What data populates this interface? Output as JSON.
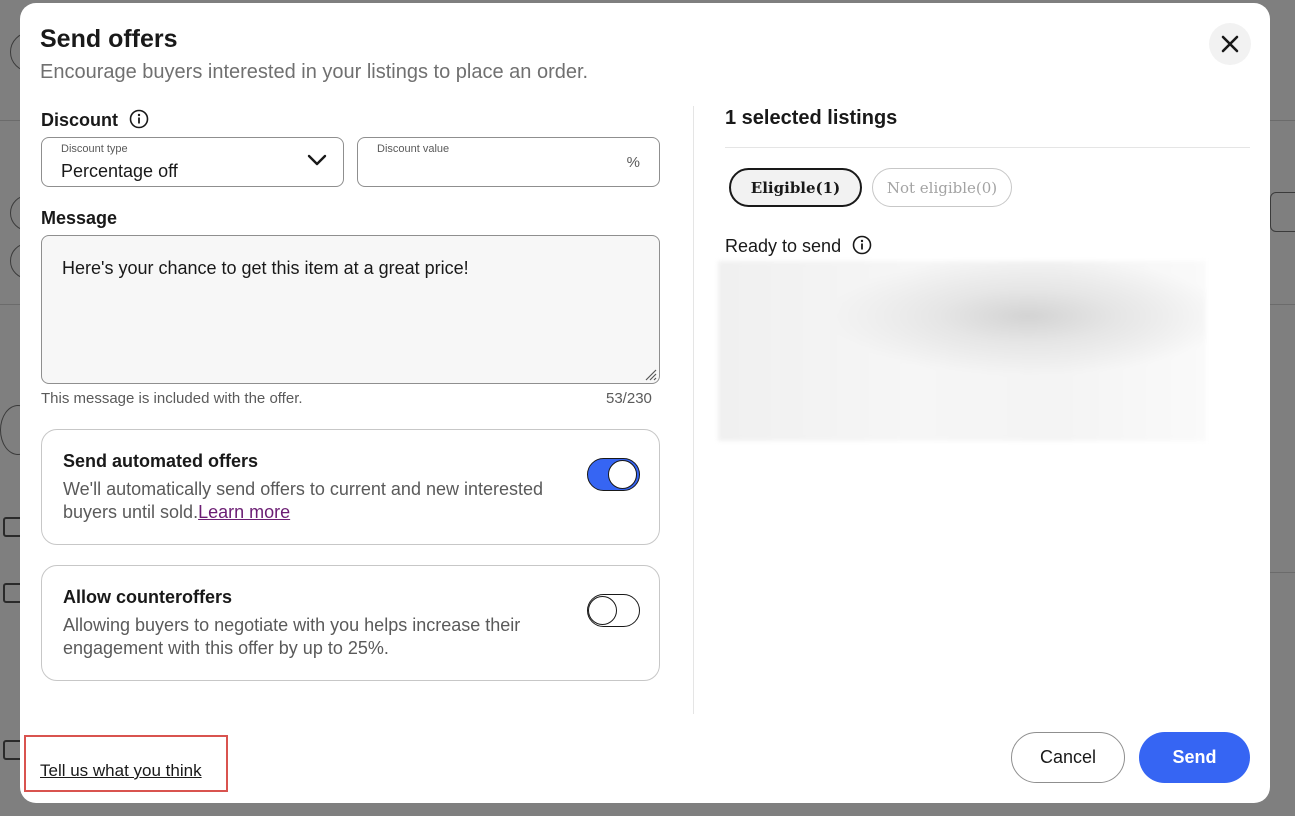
{
  "modal": {
    "title": "Send offers",
    "subtitle": "Encourage buyers interested in your listings to place an order.",
    "close_icon": "close-icon"
  },
  "discount": {
    "label": "Discount",
    "type_label": "Discount type",
    "type_value": "Percentage off",
    "value_label": "Discount value",
    "value": "",
    "value_suffix": "%"
  },
  "message": {
    "label": "Message",
    "value": "Here's your chance to get this item at a great price!",
    "helper": "This message is included with the offer.",
    "counter": "53/230"
  },
  "automated_offers": {
    "title": "Send automated offers",
    "description": "We'll automatically send offers to current and new interested buyers until sold.",
    "link": "Learn more",
    "enabled": true
  },
  "counteroffers": {
    "title": "Allow counteroffers",
    "description": "Allowing buyers to negotiate with you helps increase their engagement with this offer by up to 25%.",
    "enabled": false
  },
  "listings": {
    "title": "1 selected listings",
    "tabs": [
      {
        "label": "Eligible(1)",
        "active": true
      },
      {
        "label": "Not eligible(0)",
        "active": false
      }
    ],
    "ready_label": "Ready to send"
  },
  "footer": {
    "feedback_link": "Tell us what you think",
    "cancel_label": "Cancel",
    "send_label": "Send"
  },
  "colors": {
    "accent": "#3665f3",
    "link_purple": "#6b1d73",
    "highlight_box": "#d9534f"
  }
}
